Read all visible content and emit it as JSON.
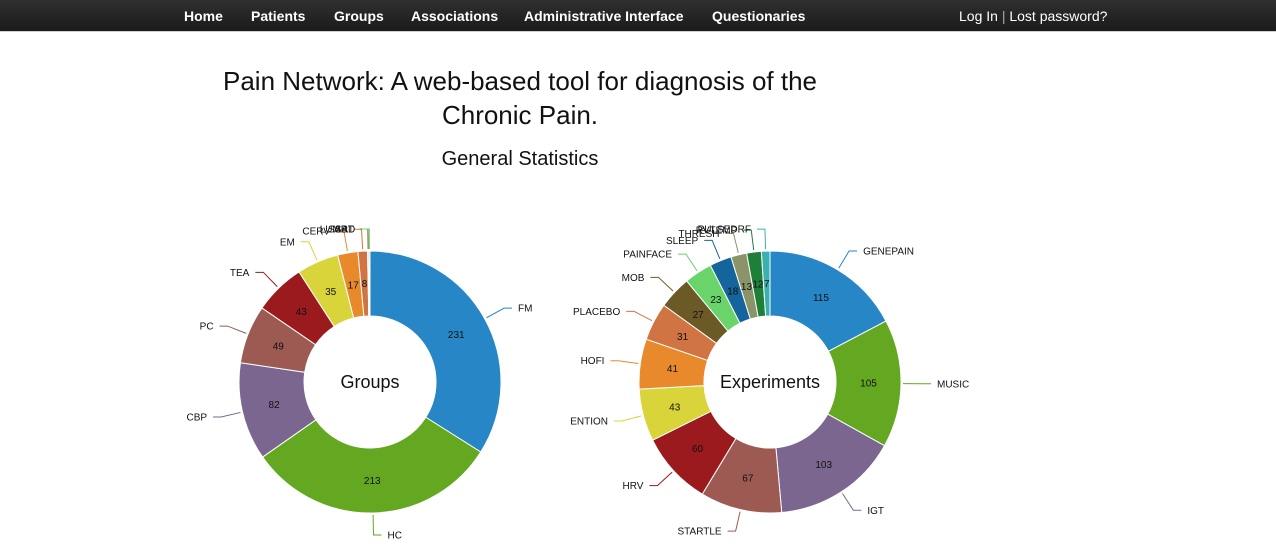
{
  "nav": {
    "items": [
      "Home",
      "Patients",
      "Groups",
      "Associations",
      "Administrative Interface",
      "Questionaries"
    ],
    "login": "Log In",
    "separator": "|",
    "lost_password": "Lost password?"
  },
  "page": {
    "title": "Pain Network: A web-based tool for diagnosis of the Chronic Pain.",
    "subtitle": "General Statistics"
  },
  "chart_data": [
    {
      "type": "pie",
      "donut": true,
      "center_label": "Groups",
      "slices": [
        {
          "label": "FM",
          "value": 231,
          "color": "#2686c6"
        },
        {
          "label": "HC",
          "value": 213,
          "color": "#64a720"
        },
        {
          "label": "CBP",
          "value": 82,
          "color": "#7b6690"
        },
        {
          "label": "PC",
          "value": 49,
          "color": "#9c5a52"
        },
        {
          "label": "TEA",
          "value": 43,
          "color": "#9b1a1d"
        },
        {
          "label": "EM",
          "value": 35,
          "color": "#d9d43a"
        },
        {
          "label": "CERV",
          "value": 17,
          "color": "#e8892b"
        },
        {
          "label": "LUMB",
          "value": 8,
          "color": "#d07444"
        },
        {
          "label": "ART",
          "value": 1,
          "color": "#6b5a25"
        },
        {
          "label": "SSAD",
          "value": 1,
          "color": "#69d469"
        }
      ]
    },
    {
      "type": "pie",
      "donut": true,
      "center_label": "Experiments",
      "slices": [
        {
          "label": "GENEPAIN",
          "value": 115,
          "color": "#2686c6"
        },
        {
          "label": "MUSIC",
          "value": 105,
          "color": "#64a720"
        },
        {
          "label": "IGT",
          "value": 103,
          "color": "#7b6690"
        },
        {
          "label": "STARTLE",
          "value": 67,
          "color": "#9c5a52"
        },
        {
          "label": "HRV",
          "value": 60,
          "color": "#9b1a1d"
        },
        {
          "label": "ENTION",
          "value": 43,
          "color": "#d9d43a"
        },
        {
          "label": "HOFI",
          "value": 41,
          "color": "#e8892b"
        },
        {
          "label": "PLACEBO",
          "value": 31,
          "color": "#d07444"
        },
        {
          "label": "MOB",
          "value": 27,
          "color": "#6b5a25"
        },
        {
          "label": "PAINFACE",
          "value": 23,
          "color": "#69d469"
        },
        {
          "label": "SLEEP",
          "value": 18,
          "color": "#14659b"
        },
        {
          "label": "THRESH",
          "value": 13,
          "color": "#8a9468"
        },
        {
          "label": "RVTEMP",
          "value": 12,
          "color": "#1e7f38"
        },
        {
          "label": "PULSEDRF",
          "value": 7,
          "color": "#3ab0b0"
        }
      ]
    }
  ]
}
